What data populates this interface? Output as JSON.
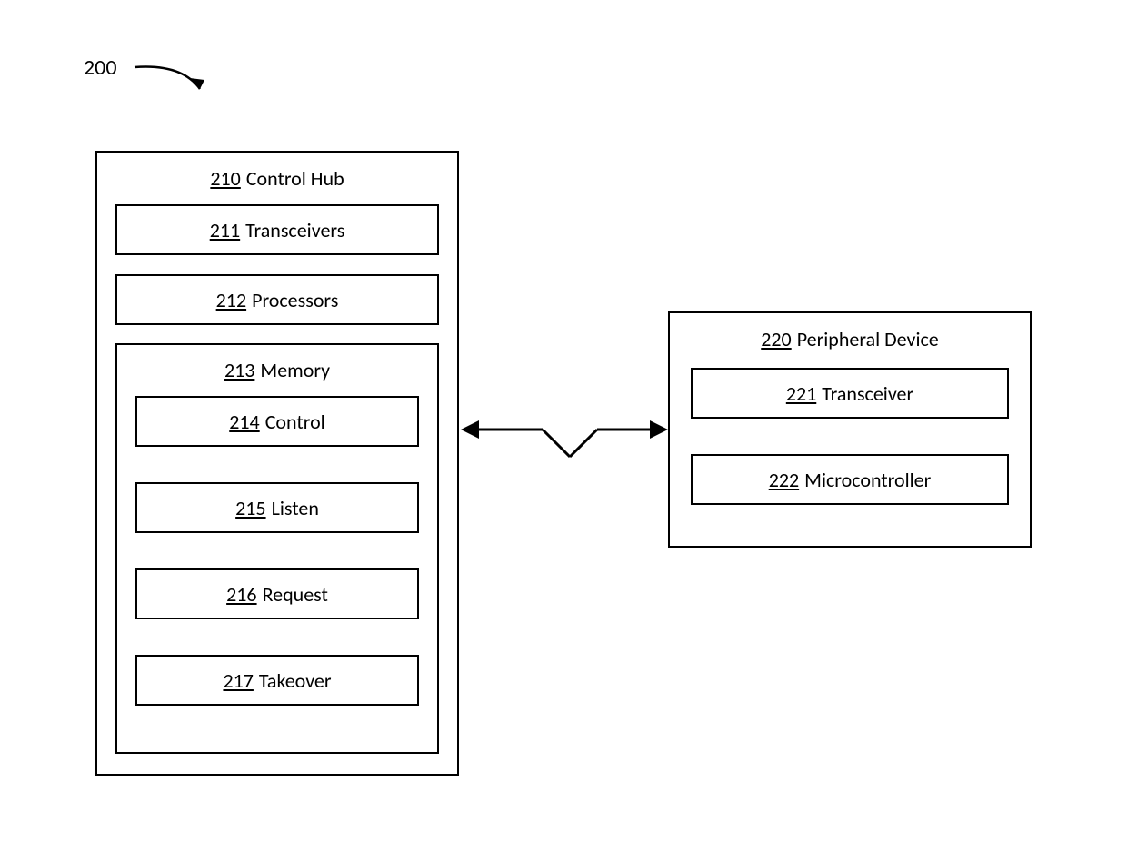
{
  "figure_ref": "200",
  "control_hub": {
    "ref": "210",
    "label": "Control Hub",
    "transceivers": {
      "ref": "211",
      "label": "Transceivers"
    },
    "processors": {
      "ref": "212",
      "label": "Processors"
    },
    "memory": {
      "ref": "213",
      "label": "Memory",
      "control": {
        "ref": "214",
        "label": "Control"
      },
      "listen": {
        "ref": "215",
        "label": "Listen"
      },
      "request": {
        "ref": "216",
        "label": "Request"
      },
      "takeover": {
        "ref": "217",
        "label": "Takeover"
      }
    }
  },
  "peripheral": {
    "ref": "220",
    "label": "Peripheral Device",
    "transceiver": {
      "ref": "221",
      "label": "Transceiver"
    },
    "microcontroller": {
      "ref": "222",
      "label": "Microcontroller"
    }
  }
}
